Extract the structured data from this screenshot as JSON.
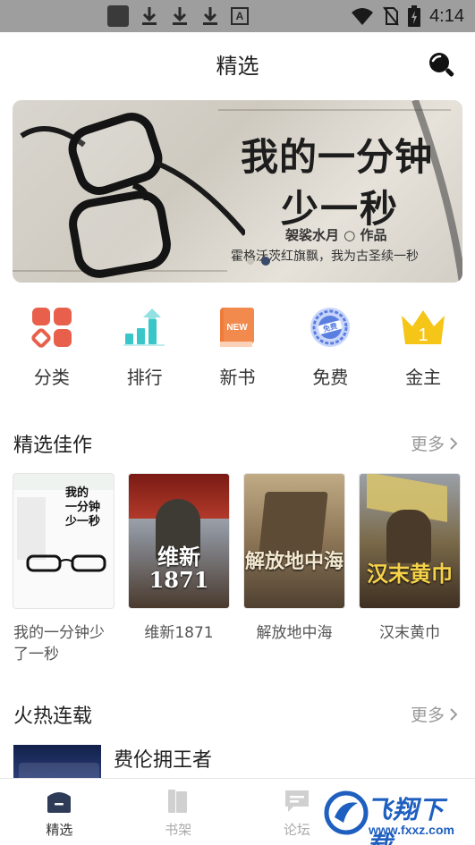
{
  "status_bar": {
    "time": "4:14",
    "icons": [
      "notification-app-icon",
      "download-icon",
      "download-icon",
      "download-icon",
      "a-icon",
      "wifi-icon",
      "no-sim-icon",
      "battery-charging-icon"
    ]
  },
  "header": {
    "title": "精选",
    "search_icon": "search-icon"
  },
  "banner": {
    "headline_line1": "我的一分钟",
    "headline_line2": "少一秒",
    "author_line": "袈裟水月 ○ 作品",
    "tagline": "霍格沃茨红旗飘，我为古圣续一秒",
    "active_index": 1,
    "slide_count": 2
  },
  "categories": [
    {
      "label": "分类",
      "icon": "category-grid-icon",
      "color": "#e8604c"
    },
    {
      "label": "排行",
      "icon": "ranking-bars-icon",
      "color": "#39c6c8"
    },
    {
      "label": "新书",
      "icon": "new-book-icon",
      "color": "#f07a3a"
    },
    {
      "label": "免费",
      "icon": "free-badge-icon",
      "color": "#5b7fe0"
    },
    {
      "label": "金主",
      "icon": "crown-icon",
      "color": "#f5c518"
    }
  ],
  "featured": {
    "title": "精选佳作",
    "more": "更多",
    "books": [
      {
        "title": "我的一分钟少了一秒",
        "cover_text": "我的一分钟少一秒"
      },
      {
        "title": "维新1871",
        "cover_text": "维新 1871"
      },
      {
        "title": "解放地中海",
        "cover_text": "解放地中海"
      },
      {
        "title": "汉末黄巾",
        "cover_text": "汉末黄巾"
      }
    ]
  },
  "hot": {
    "title": "火热连载",
    "more": "更多",
    "items": [
      {
        "title": "费伦拥王者"
      }
    ]
  },
  "tabs": [
    {
      "label": "精选",
      "active": true
    },
    {
      "label": "书架",
      "active": false
    },
    {
      "label": "论坛",
      "active": false
    }
  ],
  "watermark": {
    "text": "飞翔下载",
    "url": "www.fxxz.com"
  },
  "colors": {
    "accent": "#3b4a6b",
    "status_bar": "#9e9e9e"
  }
}
